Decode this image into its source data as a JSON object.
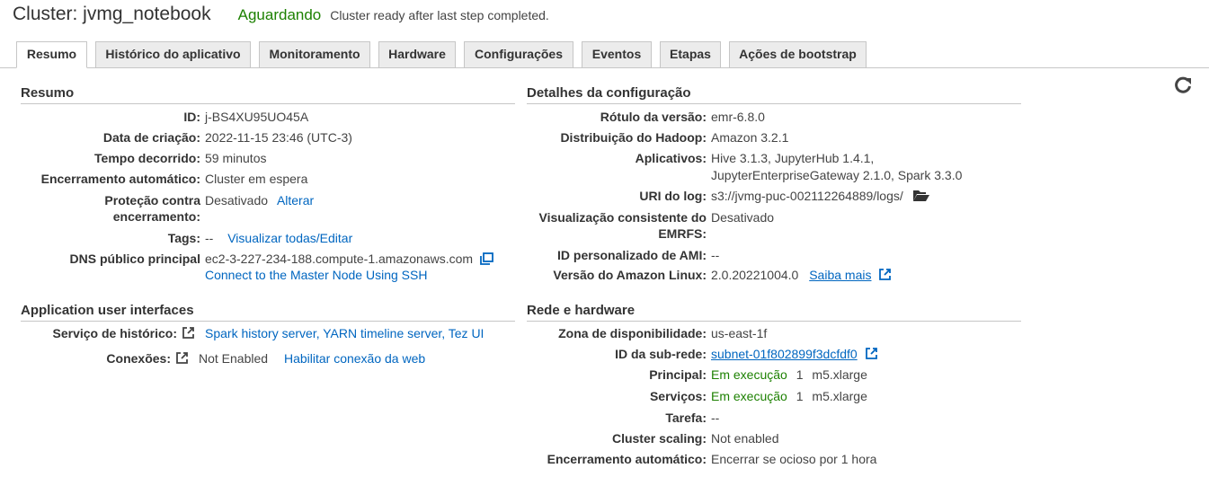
{
  "header": {
    "title": "Cluster: jvmg_notebook",
    "status": "Aguardando",
    "status_reason": "Cluster ready after last step completed."
  },
  "tabs": [
    "Resumo",
    "Histórico do aplicativo",
    "Monitoramento",
    "Hardware",
    "Configurações",
    "Eventos",
    "Etapas",
    "Ações de bootstrap"
  ],
  "summary": {
    "title": "Resumo",
    "id_label": "ID:",
    "id": "j-BS4XU95UO45A",
    "created_label": "Data de criação:",
    "created": "2022-11-15 23:46 (UTC-3)",
    "elapsed_label": "Tempo decorrido:",
    "elapsed": "59 minutos",
    "auto_term_label": "Encerramento automático:",
    "auto_term": "Cluster em espera",
    "protection_label_1": "Proteção contra",
    "protection_label_2": "encerramento:",
    "protection": "Desativado",
    "protection_change": "Alterar",
    "tags_label": "Tags:",
    "tags": "--",
    "tags_link": "Visualizar todas/Editar",
    "dns_label": "DNS público principal",
    "dns": "ec2-3-227-234-188.compute-1.amazonaws.com",
    "ssh_link": "Connect to the Master Node Using SSH"
  },
  "app_ui": {
    "title": "Application user interfaces",
    "history_label": "Serviço de histórico:",
    "history_links": "Spark history server, YARN timeline server, Tez UI",
    "connections_label": "Conexões:",
    "connections": "Not Enabled",
    "connections_link": "Habilitar conexão da web"
  },
  "config": {
    "title": "Detalhes da configuração",
    "release_label": "Rótulo da versão:",
    "release": "emr-6.8.0",
    "hadoop_label": "Distribuição do Hadoop:",
    "hadoop": "Amazon 3.2.1",
    "apps_label": "Aplicativos:",
    "apps_line1": "Hive 3.1.3, JupyterHub 1.4.1,",
    "apps_line2": "JupyterEnterpriseGateway 2.1.0, Spark 3.3.0",
    "log_label": "URI do log:",
    "log": "s3://jvmg-puc-002112264889/logs/",
    "emrfs_label_1": "Visualização consistente do",
    "emrfs_label_2": "EMRFS:",
    "emrfs": "Desativado",
    "ami_label": "ID personalizado de AMI:",
    "ami": "--",
    "linux_label": "Versão do Amazon Linux:",
    "linux": "2.0.20221004.0",
    "linux_link": "Saiba mais"
  },
  "network": {
    "title": "Rede e hardware",
    "az_label": "Zona de disponibilidade:",
    "az": "us-east-1f",
    "subnet_label": "ID da sub-rede:",
    "subnet": "subnet-01f802899f3dcfdf0",
    "master_label": "Principal:",
    "master_status": "Em execução",
    "master_count": "1",
    "master_type": "m5.xlarge",
    "core_label": "Serviços:",
    "core_status": "Em execução",
    "core_count": "1",
    "core_type": "m5.xlarge",
    "task_label": "Tarefa:",
    "task": "--",
    "scaling_label": "Cluster scaling:",
    "scaling": "Not enabled",
    "auto_term_label": "Encerramento automático:",
    "auto_term": "Encerrar se ocioso por 1 hora"
  }
}
